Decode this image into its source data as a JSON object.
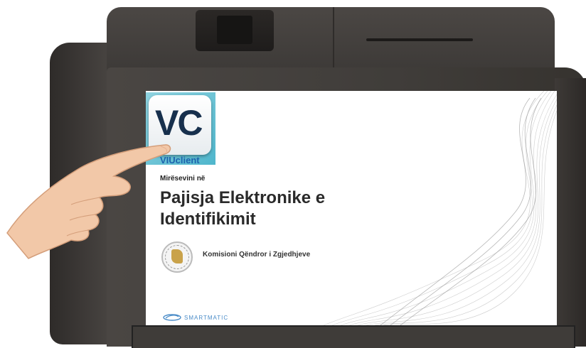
{
  "app": {
    "icon_letters": "VC",
    "icon_label": "VIUclient"
  },
  "screen": {
    "welcome": "Mirësevini në",
    "title": "Pajisja Elektronike e Identifikimit",
    "organization": "Komisioni Qëndror i Zgjedhjeve",
    "brand": "SMARTMATIC"
  },
  "colors": {
    "device_body": "#3f3c39",
    "tile_bg": "#4fb6cc",
    "tile_letters": "#17304d",
    "tile_label": "#1e62ad",
    "brand": "#4a8cc8"
  },
  "icons": {
    "app": "vc-app-icon",
    "seal": "cec-seal-icon",
    "brand": "smartmatic-logo-icon",
    "hand": "pointing-hand-icon"
  }
}
